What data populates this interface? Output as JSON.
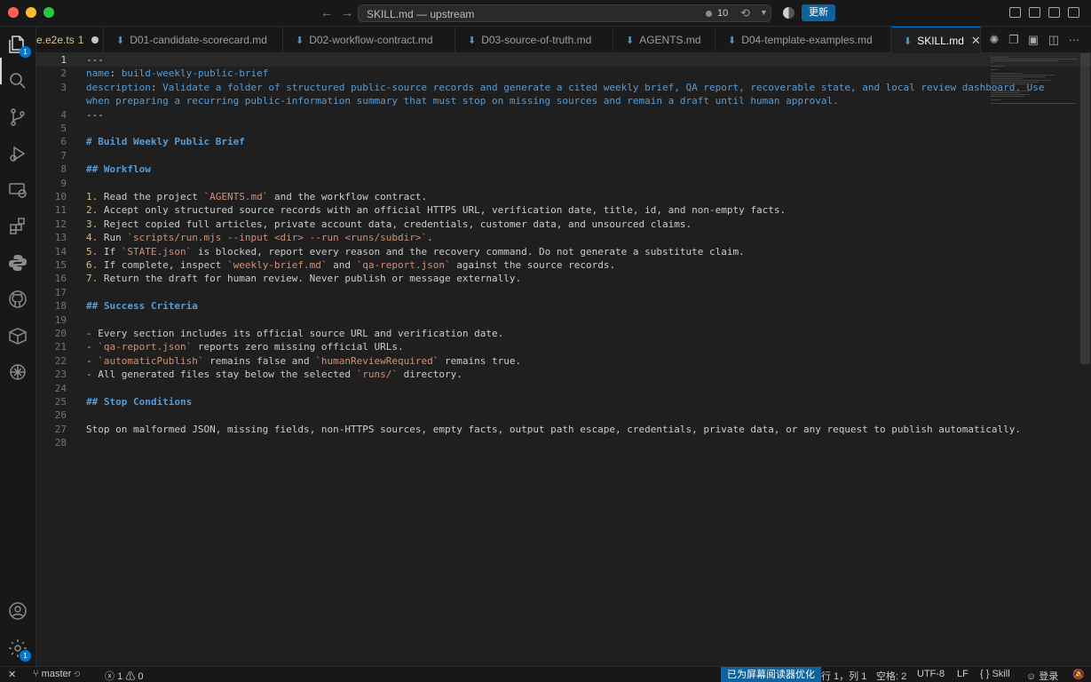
{
  "window": {
    "title": "SKILL.md — upstream",
    "source_control_count": "10",
    "update_button": "更新"
  },
  "activity_bar": {
    "explorer_badge": "1",
    "settings_badge": "1"
  },
  "tabs": [
    {
      "label": "e.e2e.ts",
      "modified_count": "1",
      "dirty": true
    },
    {
      "label": "D01-candidate-scorecard.md"
    },
    {
      "label": "D02-workflow-contract.md"
    },
    {
      "label": "D03-source-of-truth.md"
    },
    {
      "label": "AGENTS.md"
    },
    {
      "label": "D04-template-examples.md"
    },
    {
      "label": "SKILL.md",
      "active": true,
      "close": "✕"
    }
  ],
  "editor": {
    "lines": [
      {
        "n": "1",
        "parts": [
          {
            "t": "---",
            "k": "meta"
          }
        ]
      },
      {
        "n": "2",
        "parts": [
          {
            "t": "name",
            "k": "key"
          },
          {
            "t": ": ",
            "k": "val"
          },
          {
            "t": "build-weekly-public-brief",
            "k": "key"
          }
        ]
      },
      {
        "n": "3",
        "parts": [
          {
            "t": "description",
            "k": "key"
          },
          {
            "t": ": ",
            "k": "val"
          },
          {
            "t": "Validate a folder of structured public-source records and generate a cited weekly brief, QA report, recoverable state, and local review dashboard. Use",
            "k": "key"
          }
        ]
      },
      {
        "n": "",
        "parts": [
          {
            "t": "when preparing a recurring public-information summary that must stop on missing sources and remain a draft until human approval.",
            "k": "key"
          }
        ]
      },
      {
        "n": "4",
        "parts": [
          {
            "t": "---",
            "k": "meta"
          }
        ]
      },
      {
        "n": "5",
        "parts": []
      },
      {
        "n": "6",
        "parts": [
          {
            "t": "# Build Weekly Public Brief",
            "k": "head"
          }
        ]
      },
      {
        "n": "7",
        "parts": []
      },
      {
        "n": "8",
        "parts": [
          {
            "t": "## Workflow",
            "k": "head"
          }
        ]
      },
      {
        "n": "9",
        "parts": []
      },
      {
        "n": "10",
        "parts": [
          {
            "t": "1.",
            "k": "num"
          },
          {
            "t": " Read the project ",
            "k": "val"
          },
          {
            "t": "`AGENTS.md`",
            "k": "inline"
          },
          {
            "t": " and the workflow contract.",
            "k": "val"
          }
        ]
      },
      {
        "n": "11",
        "parts": [
          {
            "t": "2.",
            "k": "num"
          },
          {
            "t": " Accept only structured source records with an official HTTPS URL, verification date, title, id, and non-empty facts.",
            "k": "val"
          }
        ]
      },
      {
        "n": "12",
        "parts": [
          {
            "t": "3.",
            "k": "num"
          },
          {
            "t": " Reject copied full articles, private account data, credentials, customer data, and unsourced claims.",
            "k": "val"
          }
        ]
      },
      {
        "n": "13",
        "parts": [
          {
            "t": "4.",
            "k": "num"
          },
          {
            "t": " Run ",
            "k": "val"
          },
          {
            "t": "`scripts/run.mjs --input <dir> --run <runs/subdir>`",
            "k": "inline"
          },
          {
            "t": ".",
            "k": "val"
          }
        ]
      },
      {
        "n": "14",
        "parts": [
          {
            "t": "5.",
            "k": "num"
          },
          {
            "t": " If ",
            "k": "val"
          },
          {
            "t": "`STATE.json`",
            "k": "inline"
          },
          {
            "t": " is blocked, report every reason and the recovery command. Do not generate a substitute claim.",
            "k": "val"
          }
        ]
      },
      {
        "n": "15",
        "parts": [
          {
            "t": "6.",
            "k": "num"
          },
          {
            "t": " If complete, inspect ",
            "k": "val"
          },
          {
            "t": "`weekly-brief.md`",
            "k": "inline"
          },
          {
            "t": " and ",
            "k": "val"
          },
          {
            "t": "`qa-report.json`",
            "k": "inline"
          },
          {
            "t": " against the source records.",
            "k": "val"
          }
        ]
      },
      {
        "n": "16",
        "parts": [
          {
            "t": "7.",
            "k": "num"
          },
          {
            "t": " Return the draft for human review. Never publish or message externally.",
            "k": "val"
          }
        ]
      },
      {
        "n": "17",
        "parts": []
      },
      {
        "n": "18",
        "parts": [
          {
            "t": "## Success Criteria",
            "k": "head"
          }
        ]
      },
      {
        "n": "19",
        "parts": []
      },
      {
        "n": "20",
        "parts": [
          {
            "t": "-",
            "k": "num"
          },
          {
            "t": " Every section includes its official source URL and verification date.",
            "k": "val"
          }
        ]
      },
      {
        "n": "21",
        "parts": [
          {
            "t": "-",
            "k": "num"
          },
          {
            "t": " ",
            "k": "val"
          },
          {
            "t": "`qa-report.json`",
            "k": "inline"
          },
          {
            "t": " reports zero missing official URLs.",
            "k": "val"
          }
        ]
      },
      {
        "n": "22",
        "parts": [
          {
            "t": "-",
            "k": "num"
          },
          {
            "t": " ",
            "k": "val"
          },
          {
            "t": "`automaticPublish`",
            "k": "inline"
          },
          {
            "t": " remains false and ",
            "k": "val"
          },
          {
            "t": "`humanReviewRequired`",
            "k": "inline"
          },
          {
            "t": " remains true.",
            "k": "val"
          }
        ]
      },
      {
        "n": "23",
        "parts": [
          {
            "t": "-",
            "k": "num"
          },
          {
            "t": " All generated files stay below the selected ",
            "k": "val"
          },
          {
            "t": "`runs/`",
            "k": "inline"
          },
          {
            "t": " directory.",
            "k": "val"
          }
        ]
      },
      {
        "n": "24",
        "parts": []
      },
      {
        "n": "25",
        "parts": [
          {
            "t": "## Stop Conditions",
            "k": "head"
          }
        ]
      },
      {
        "n": "26",
        "parts": []
      },
      {
        "n": "27",
        "parts": [
          {
            "t": "Stop on malformed JSON, missing fields, non-HTTPS sources, empty facts, output path escape, credentials, private data, or any request to publish automatically.",
            "k": "val"
          }
        ]
      },
      {
        "n": "28",
        "parts": []
      }
    ]
  },
  "statusbar": {
    "branch": "master",
    "errors": "1",
    "warnings": "0",
    "screen_reader": "已为屏幕阅读器优化",
    "position": "行 1，列 1",
    "indent": "空格: 2",
    "encoding": "UTF-8",
    "eol": "LF",
    "language": "Skill",
    "login": "登录"
  },
  "colors": {
    "accent": "#0078d4",
    "update_button": "#0e639c",
    "yaml_key": "#569cd6",
    "inline_code": "#ce9178",
    "list_number": "#d7ba7d",
    "modified_tab": "#e2c08d"
  }
}
